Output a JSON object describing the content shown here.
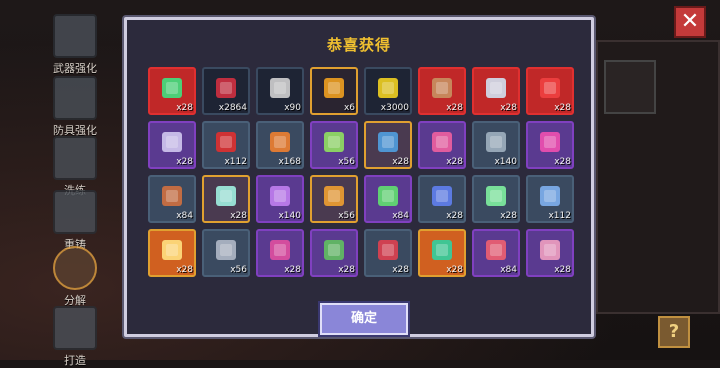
{
  "dialog": {
    "title": "恭喜获得",
    "confirm_label": "确定"
  },
  "menu": [
    {
      "label": "武器强化",
      "icon": "sword-icon"
    },
    {
      "label": "防具强化",
      "icon": "armor-icon"
    },
    {
      "label": "洗练",
      "icon": "refine-icon"
    },
    {
      "label": "重铸",
      "icon": "reforge-icon"
    },
    {
      "label": "分解",
      "icon": "decompose-icon",
      "active": true
    },
    {
      "label": "打造",
      "icon": "forge-icon"
    }
  ],
  "items": [
    {
      "qty": "x28",
      "icon": "green-sword-icon",
      "border": "#e03030",
      "fill": "#c02828",
      "accent": "#40e080"
    },
    {
      "qty": "x2864",
      "icon": "red-crystal-icon",
      "border": "#3a4a60",
      "fill": "#1e2434",
      "accent": "#d03040"
    },
    {
      "qty": "x90",
      "icon": "ore-pile-icon",
      "border": "#3a4a60",
      "fill": "#1e2434",
      "accent": "#d0d0d0"
    },
    {
      "qty": "x6",
      "icon": "gold-pile-icon",
      "border": "#e0a030",
      "fill": "#2a2430",
      "accent": "#f0a020"
    },
    {
      "qty": "x3000",
      "icon": "gold-coin-icon",
      "border": "#3a4a60",
      "fill": "#1e2434",
      "accent": "#f0d020"
    },
    {
      "qty": "x28",
      "icon": "monster-face-icon",
      "border": "#e03030",
      "fill": "#c02828",
      "accent": "#c89060"
    },
    {
      "qty": "x28",
      "icon": "shuriken-icon",
      "border": "#e03030",
      "fill": "#c02828",
      "accent": "#d0e0f0"
    },
    {
      "qty": "x28",
      "icon": "red-blade-icon",
      "border": "#e03030",
      "fill": "#c02828",
      "accent": "#f04040"
    },
    {
      "qty": "x28",
      "icon": "purple-sword-icon",
      "border": "#8040c0",
      "fill": "#5a3a90",
      "accent": "#d0c8f0"
    },
    {
      "qty": "x112",
      "icon": "red-staff-icon",
      "border": "#4a6078",
      "fill": "#3a4a60",
      "accent": "#e03030"
    },
    {
      "qty": "x168",
      "icon": "lantern-icon",
      "border": "#4a6078",
      "fill": "#3a4a60",
      "accent": "#f08030"
    },
    {
      "qty": "x56",
      "icon": "gun-icon",
      "border": "#8040c0",
      "fill": "#5a3a90",
      "accent": "#90e060"
    },
    {
      "qty": "x28",
      "icon": "cross-shield-icon",
      "border": "#e0a030",
      "fill": "#4a3a50",
      "accent": "#50a0e0"
    },
    {
      "qty": "x28",
      "icon": "wand-icon",
      "border": "#8040c0",
      "fill": "#5a3a90",
      "accent": "#f060a0"
    },
    {
      "qty": "x140",
      "icon": "pistol-icon",
      "border": "#4a6078",
      "fill": "#3a4a60",
      "accent": "#a0b0c0"
    },
    {
      "qty": "x28",
      "icon": "pink-mask-icon",
      "border": "#8040c0",
      "fill": "#5a3a90",
      "accent": "#f050b0"
    },
    {
      "qty": "x84",
      "icon": "rifle-icon",
      "border": "#4a6078",
      "fill": "#3a4a60",
      "accent": "#d07040"
    },
    {
      "qty": "x28",
      "icon": "skull-helmet-icon",
      "border": "#e0a030",
      "fill": "#4a3a50",
      "accent": "#a0f0e0"
    },
    {
      "qty": "x140",
      "icon": "purple-helmet-icon",
      "border": "#8040c0",
      "fill": "#5a3a90",
      "accent": "#c080f0"
    },
    {
      "qty": "x56",
      "icon": "pickaxe-icon",
      "border": "#e0a030",
      "fill": "#4a3a50",
      "accent": "#f0a030"
    },
    {
      "qty": "x84",
      "icon": "green-eye-icon",
      "border": "#8040c0",
      "fill": "#5a3a90",
      "accent": "#60e070"
    },
    {
      "qty": "x28",
      "icon": "blue-rocket-icon",
      "border": "#4a6078",
      "fill": "#3a4a60",
      "accent": "#6080f0"
    },
    {
      "qty": "x28",
      "icon": "green-potion-icon",
      "border": "#4a6078",
      "fill": "#3a4a60",
      "accent": "#80f0a0"
    },
    {
      "qty": "x112",
      "icon": "blue-spear-icon",
      "border": "#4a6078",
      "fill": "#3a4a60",
      "accent": "#80b0f0"
    },
    {
      "qty": "x28",
      "icon": "mystery-box-icon",
      "border": "#e0a030",
      "fill": "#d06020",
      "accent": "#ffe080"
    },
    {
      "qty": "x56",
      "icon": "bracer-icon",
      "border": "#4a6078",
      "fill": "#3a4a60",
      "accent": "#b0b8c8"
    },
    {
      "qty": "x28",
      "icon": "purple-shield-icon",
      "border": "#8040c0",
      "fill": "#5a3a90",
      "accent": "#e050a0"
    },
    {
      "qty": "x28",
      "icon": "cactus-icon",
      "border": "#8040c0",
      "fill": "#5a3a90",
      "accent": "#60c060"
    },
    {
      "qty": "x28",
      "icon": "red-spear-icon",
      "border": "#4a6078",
      "fill": "#3a4a60",
      "accent": "#e04050"
    },
    {
      "qty": "x28",
      "icon": "gem-amulet-icon",
      "border": "#e0a030",
      "fill": "#d06020",
      "accent": "#30d0a0"
    },
    {
      "qty": "x84",
      "icon": "boomerang-icon",
      "border": "#8040c0",
      "fill": "#5a3a90",
      "accent": "#f06070"
    },
    {
      "qty": "x28",
      "icon": "horn-icon",
      "border": "#8040c0",
      "fill": "#5a3a90",
      "accent": "#f0a0c0"
    }
  ]
}
